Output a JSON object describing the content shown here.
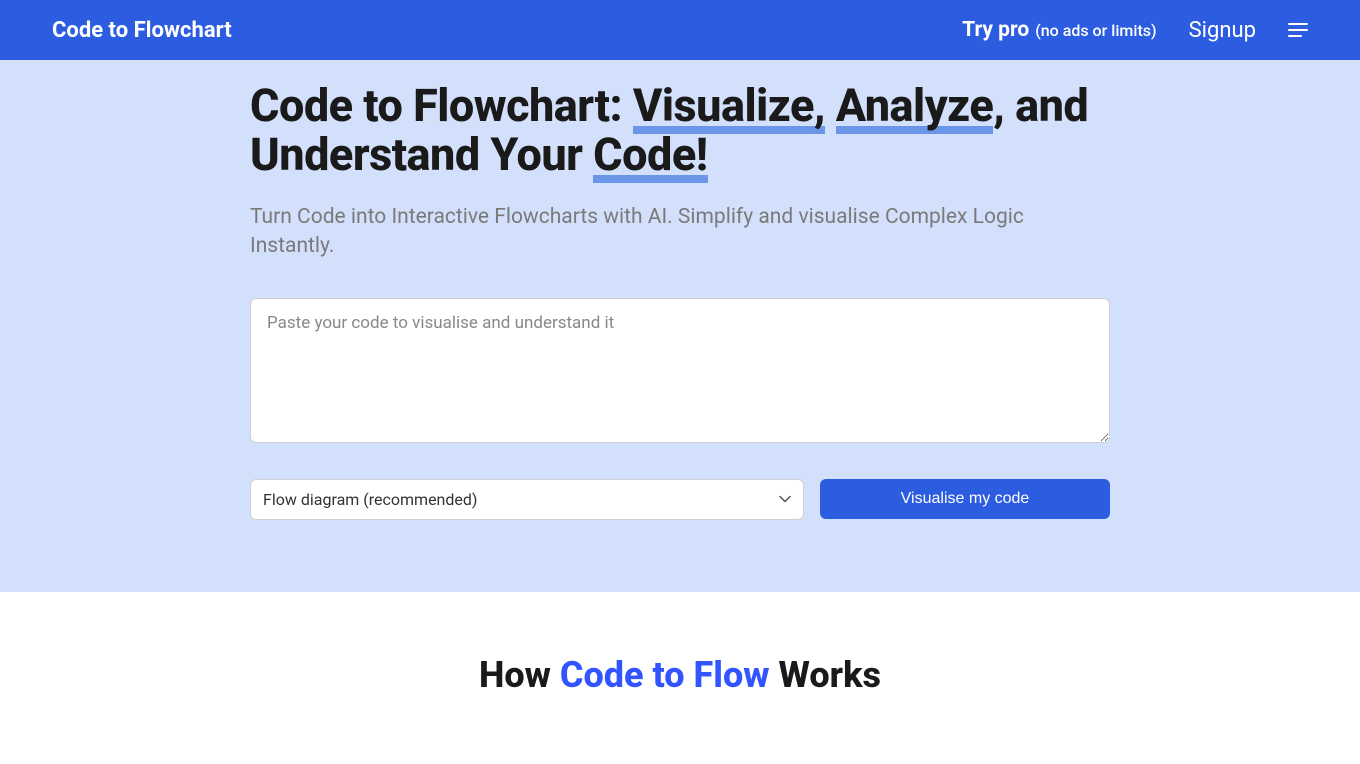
{
  "header": {
    "logo": "Code to Flowchart",
    "tryPro": "Try pro",
    "tryProSub": "(no ads or limits)",
    "signup": "Signup"
  },
  "hero": {
    "titlePrefix": "Code to Flowchart: ",
    "titleUnderline1": "Visualize,",
    "titleUnderline2": "Analyze",
    "titleMiddle": ", ",
    "titleUnderline3": "and Understand Your",
    "titleUnderline4": "Code!",
    "subtitle": "Turn Code into Interactive Flowcharts with AI. Simplify and visualise Complex Logic Instantly.",
    "placeholder": "Paste your code to visualise and understand it",
    "selectValue": "Flow diagram (recommended)",
    "buttonLabel": "Visualise my code"
  },
  "howSection": {
    "prefix": "How ",
    "highlight": "Code to Flow",
    "suffix": " Works"
  }
}
